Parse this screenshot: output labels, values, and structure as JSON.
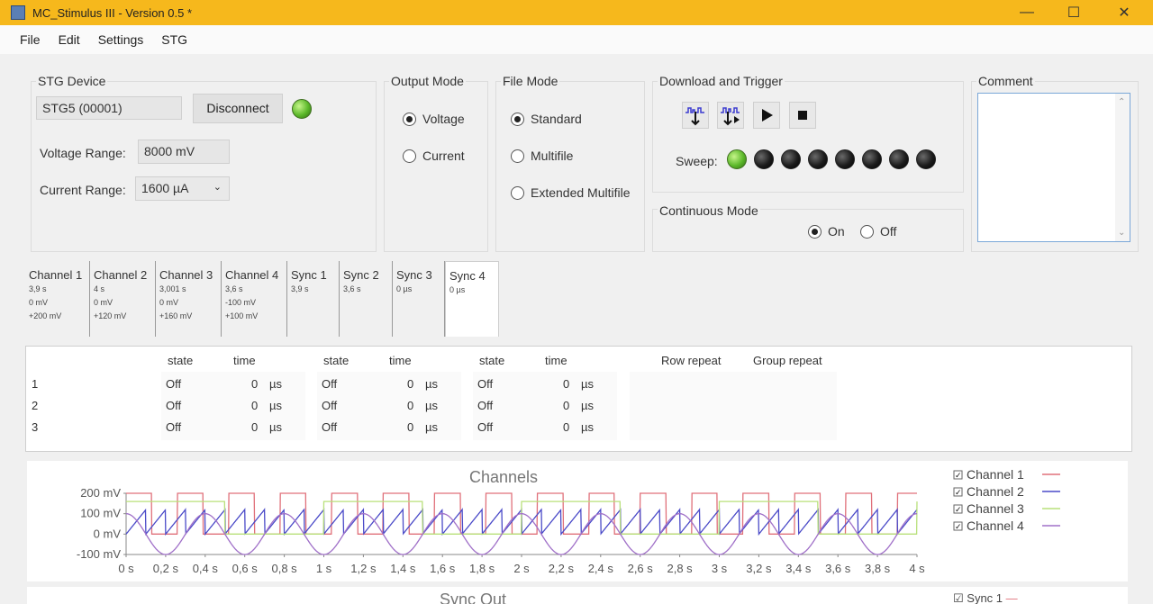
{
  "window": {
    "title": "MC_Stimulus III - Version 0.5 *",
    "controls": {
      "minimize": "—",
      "maximize": "☐",
      "close": "✕"
    }
  },
  "menu": [
    "File",
    "Edit",
    "Settings",
    "STG"
  ],
  "stg_device": {
    "title": "STG Device",
    "device": "STG5 (00001)",
    "disconnect": "Disconnect",
    "voltage_label": "Voltage Range:",
    "voltage_value": "8000 mV",
    "current_label": "Current Range:",
    "current_value": "1600 µA"
  },
  "output_mode": {
    "title": "Output Mode",
    "options": [
      "Voltage",
      "Current"
    ],
    "selected": "Voltage"
  },
  "file_mode": {
    "title": "File Mode",
    "options": [
      "Standard",
      "Multifile",
      "Extended Multifile"
    ],
    "selected": "Standard"
  },
  "download": {
    "title": "Download and Trigger",
    "sweep_label": "Sweep:",
    "sweep_leds": [
      "green",
      "dark",
      "dark",
      "dark",
      "dark",
      "dark",
      "dark",
      "dark"
    ]
  },
  "continuous": {
    "title": "Continuous Mode",
    "on": "On",
    "off": "Off",
    "selected": "On"
  },
  "comment": {
    "title": "Comment",
    "value": ""
  },
  "tabs": [
    {
      "name": "Channel 1",
      "lines": [
        "3,9 s",
        "0 mV",
        "+200 mV"
      ]
    },
    {
      "name": "Channel 2",
      "lines": [
        "4 s",
        "0 mV",
        "+120 mV"
      ]
    },
    {
      "name": "Channel 3",
      "lines": [
        "3,001 s",
        "0 mV",
        "+160 mV"
      ]
    },
    {
      "name": "Channel 4",
      "lines": [
        "3,6 s",
        "-100 mV",
        "+100 mV"
      ]
    },
    {
      "name": "Sync 1",
      "lines": [
        "3,9 s"
      ]
    },
    {
      "name": "Sync 2",
      "lines": [
        "3,6 s"
      ]
    },
    {
      "name": "Sync 3",
      "lines": [
        "0 µs"
      ]
    },
    {
      "name": "Sync 4",
      "lines": [
        "0 µs"
      ],
      "active": true
    }
  ],
  "table": {
    "headers": {
      "state": "state",
      "time": "time",
      "row_repeat": "Row repeat",
      "group_repeat": "Group repeat"
    },
    "unit": "µs",
    "rows": [
      {
        "num": "1",
        "cells": [
          [
            "Off",
            "0"
          ],
          [
            "Off",
            "0"
          ],
          [
            "Off",
            "0"
          ]
        ]
      },
      {
        "num": "2",
        "cells": [
          [
            "Off",
            "0"
          ],
          [
            "Off",
            "0"
          ],
          [
            "Off",
            "0"
          ]
        ]
      },
      {
        "num": "3",
        "cells": [
          [
            "Off",
            "0"
          ],
          [
            "Off",
            "0"
          ],
          [
            "Off",
            "0"
          ]
        ]
      }
    ]
  },
  "chart_data": {
    "type": "line",
    "title": "Channels",
    "x_ticks": [
      "0 s",
      "0,2 s",
      "0,4 s",
      "0,6 s",
      "0,8 s",
      "1 s",
      "1,2 s",
      "1,4 s",
      "1,6 s",
      "1,8 s",
      "2 s",
      "2,2 s",
      "2,4 s",
      "2,6 s",
      "2,8 s",
      "3 s",
      "3,2 s",
      "3,4 s",
      "3,6 s",
      "3,8 s",
      "4 s"
    ],
    "y_ticks": [
      "200 mV",
      "100 mV",
      "0 mV",
      "-100 mV"
    ],
    "xlim": [
      0,
      4
    ],
    "ylim": [
      -100,
      200
    ],
    "legend": "right",
    "series": [
      {
        "name": "Channel 1",
        "color": "#e0707a",
        "shape": "square",
        "low": 0,
        "high": 200,
        "period": 0.26
      },
      {
        "name": "Channel 2",
        "color": "#4a4ac8",
        "shape": "sawtooth",
        "low": 0,
        "high": 120,
        "period": 0.1
      },
      {
        "name": "Channel 3",
        "color": "#b8e07a",
        "shape": "square",
        "low": 0,
        "high": 160,
        "period": 1.0
      },
      {
        "name": "Channel 4",
        "color": "#a070c8",
        "shape": "sine",
        "low": -100,
        "high": 100,
        "period": 0.4
      }
    ]
  },
  "sync_out": {
    "title": "Sync Out",
    "legend_first": "Sync 1"
  }
}
